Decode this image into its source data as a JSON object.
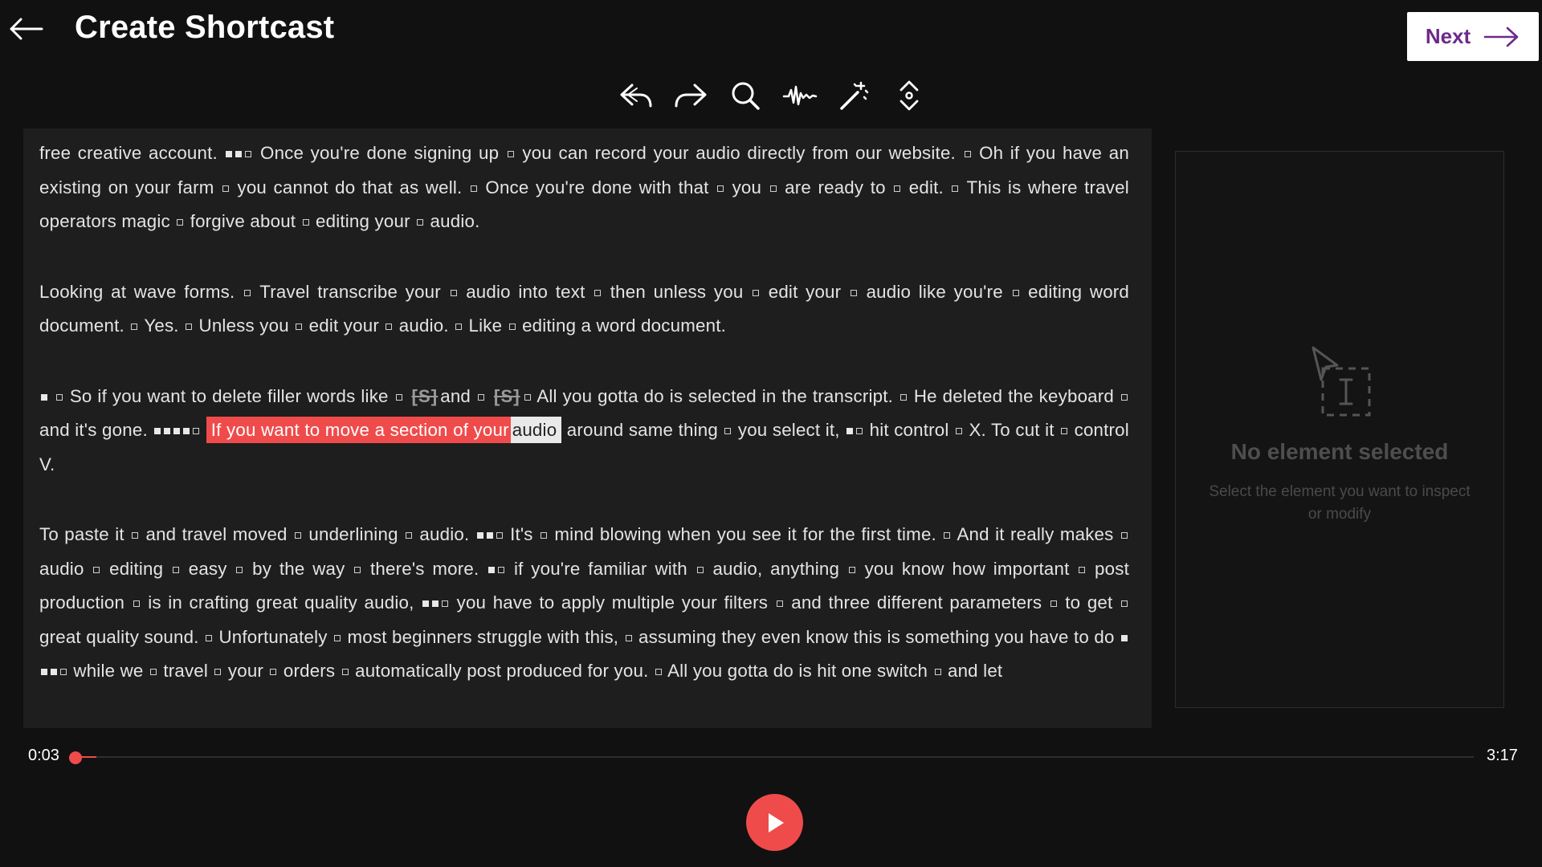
{
  "header": {
    "title": "Create Shortcast",
    "next_label": "Next"
  },
  "icons": {
    "back": "arrow-left-icon",
    "next": "arrow-right-icon",
    "undo": "undo-icon",
    "redo": "redo-icon",
    "search": "search-icon",
    "waveform": "waveform-icon",
    "magic": "magic-wand-icon",
    "expand": "expand-collapse-icon",
    "panel": "select-element-icon",
    "play": "play-icon"
  },
  "colors": {
    "accent": "#ef4b4b",
    "background": "#111111",
    "panel": "#1e1e1e",
    "next_text": "#6c2a8a"
  },
  "transcript": {
    "p1": {
      "a": "free creative account.",
      "b": "Once you're done signing up",
      "c": "you can record your audio directly from our website.",
      "d": "Oh if you have an existing on your farm",
      "e": "you cannot do that as well.",
      "f": "Once you're done with that",
      "g": "you",
      "h": "are ready to",
      "i": "edit.",
      "j": "This is where travel operators magic",
      "k": "forgive about",
      "l": "editing your",
      "m": "audio."
    },
    "p2": {
      "a": "Looking at wave forms.",
      "b": "Travel transcribe your",
      "c": "audio into text",
      "d": "then unless you",
      "e": "edit your",
      "f": "audio like you're",
      "g": "editing word document.",
      "h": "Yes.",
      "i": "Unless you",
      "j": "edit your",
      "k": "audio.",
      "l": "Like",
      "m": "editing a word document."
    },
    "p3": {
      "a": "So if you want to delete filler words like",
      "filler": "[S]",
      "b": "and",
      "c": "All you gotta do is selected in the transcript.",
      "d": "He deleted the keyboard",
      "e": "and it's gone.",
      "sel_red": "If you want to move a section of your",
      "sel_white": "audio",
      "f": "around same thing",
      "g": "you select it,",
      "h": "hit control",
      "i": "X. To cut it",
      "j": "control V."
    },
    "p4": {
      "a": "To paste it",
      "b": "and travel moved",
      "c": "underlining",
      "d": "audio.",
      "e": "It's",
      "f": "mind blowing when you see it for the first time.",
      "g": "And it really makes",
      "h": "audio",
      "i": "editing",
      "j": "easy",
      "k": "by the way",
      "l": "there's more.",
      "m": "if you're familiar with",
      "n": "audio, anything",
      "o": "you know how important",
      "p": "post production",
      "q": "is in crafting great quality audio,",
      "r": "you have to apply multiple your filters",
      "s": "and three different parameters",
      "t": "to get",
      "u": "great quality sound.",
      "v": "Unfortunately",
      "w": "most beginners struggle with this,",
      "x": "assuming they even know this is something you have to do",
      "y": "while we",
      "z": "travel",
      "aa": "your",
      "bb": "orders",
      "cc": "automatically post produced for you.",
      "dd": "All you gotta do is hit one switch",
      "ee": "and let"
    }
  },
  "panel": {
    "title": "No element selected",
    "subtitle": "Select the element you want to inspect or modify"
  },
  "player": {
    "current_time": "0:03",
    "total_time": "3:17",
    "progress": 0.016
  }
}
